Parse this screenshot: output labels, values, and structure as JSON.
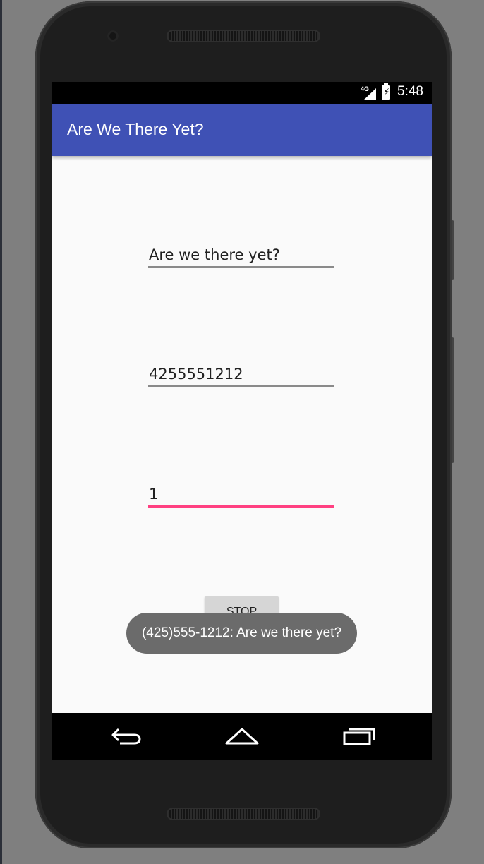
{
  "status_bar": {
    "network": "4G",
    "time": "5:48"
  },
  "app_bar": {
    "title": "Are We There Yet?"
  },
  "form": {
    "message_value": "Are we there yet?",
    "phone_value": "4255551212",
    "interval_value": "1",
    "stop_label": "STOP"
  },
  "toast": {
    "text": "(425)555-1212: Are we there yet?"
  },
  "nav": {
    "icons": [
      "back-icon",
      "home-icon",
      "recents-icon"
    ]
  },
  "colors": {
    "app_bar": "#3f51b5",
    "accent": "#ff4081",
    "background": "#fafafa"
  }
}
